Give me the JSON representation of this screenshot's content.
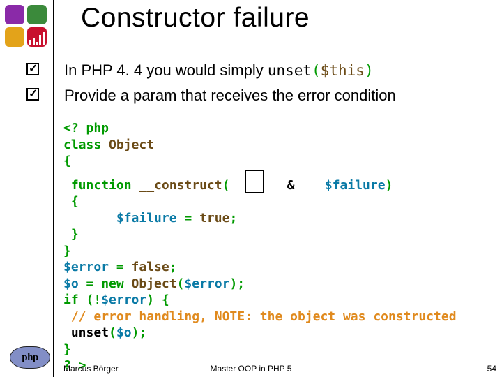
{
  "title": "Constructor failure",
  "bullets": {
    "b1_pre": "In PHP 4. 4 you would simply ",
    "b1_code1": "unset",
    "b1_code2": "(",
    "b1_code3": "$this",
    "b1_code4": ")",
    "b2": "Provide a param that receives the error condition"
  },
  "code": {
    "l1": "<? php",
    "l2a": "class ",
    "l2b": "Object",
    "l3": "{",
    "l4a": "function ",
    "l4b": "__construct",
    "l4c": "(",
    "l4amp": "&",
    "l4d": "$failure",
    "l4e": ")",
    "l5": "{",
    "l6a": "$failure ",
    "l6b": "= ",
    "l6c": "true",
    "l6d": ";",
    "l7": "}",
    "l8": "}",
    "l9a": "$error ",
    "l9b": "= ",
    "l9c": "false",
    "l9d": ";",
    "l10a": "$o ",
    "l10b": "= new ",
    "l10c": "Object",
    "l10d": "(",
    "l10e": "$error",
    "l10f": ");",
    "l11a": "if (!",
    "l11b": "$error",
    "l11c": ") {",
    "l12": "// error handling, NOTE: the object was constructed",
    "l13a": "unset",
    "l13b": "(",
    "l13c": "$o",
    "l13d": ");",
    "l14": "}",
    "l15": "? >"
  },
  "footer": {
    "author": "Marcus Börger",
    "center": "Master OOP in PHP 5",
    "page": "54"
  },
  "phpLogo": "php"
}
